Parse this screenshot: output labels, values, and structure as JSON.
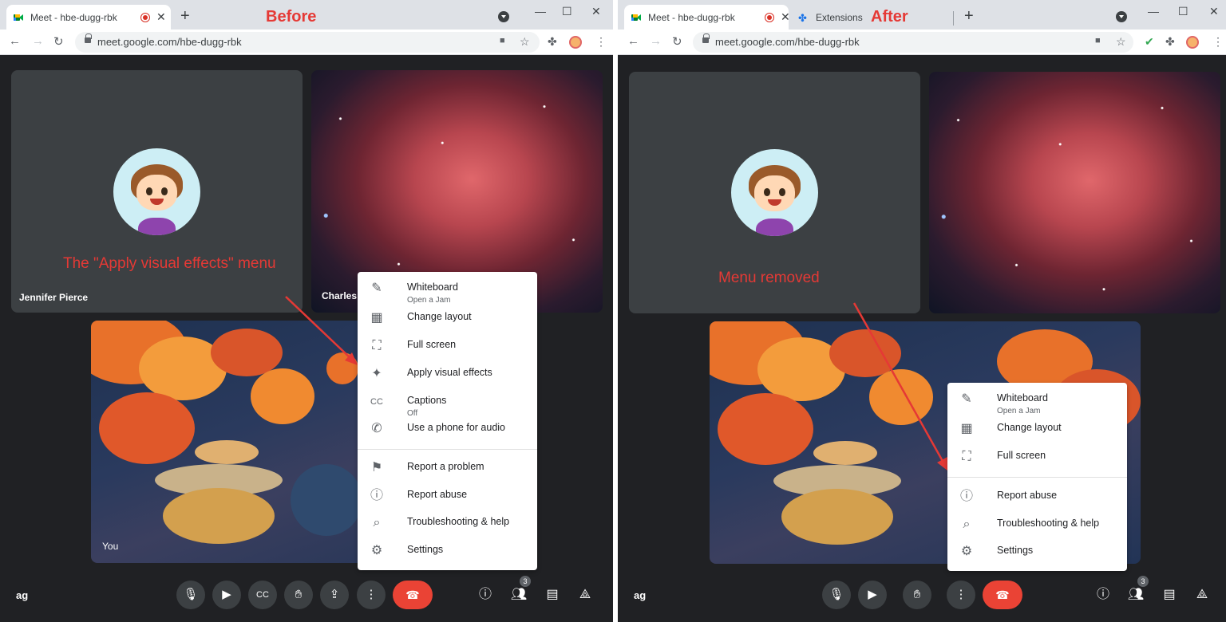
{
  "before": {
    "tabs": [
      {
        "title": "Meet - hbe-dugg-rbk"
      }
    ],
    "label": "Before",
    "url": "meet.google.com/hbe-dugg-rbk",
    "annotation": "The \"Apply visual effects\" menu",
    "participants": [
      {
        "name": "Jennifer Pierce"
      },
      {
        "name": "Charles"
      },
      {
        "name": "You"
      }
    ],
    "menu": [
      {
        "label": "Whiteboard",
        "sub": "Open a Jam",
        "icon": "pencil-icon"
      },
      {
        "label": "Change layout",
        "icon": "layout-icon"
      },
      {
        "label": "Full screen",
        "icon": "fullscreen-icon"
      },
      {
        "label": "Apply visual effects",
        "icon": "sparkle-icon"
      },
      {
        "label": "Captions",
        "sub": "Off",
        "icon": "captions-icon"
      },
      {
        "label": "Use a phone for audio",
        "icon": "phone-icon"
      },
      {
        "label": "Report a problem",
        "icon": "feedback-icon"
      },
      {
        "label": "Report abuse",
        "icon": "alert-icon"
      },
      {
        "label": "Troubleshooting & help",
        "icon": "troubleshoot-icon"
      },
      {
        "label": "Settings",
        "icon": "gear-icon"
      }
    ],
    "meeting_code": "ag",
    "people_count": "3"
  },
  "after": {
    "tabs": [
      {
        "title": "Meet - hbe-dugg-rbk"
      },
      {
        "title": "Extensions"
      }
    ],
    "label": "After",
    "url": "meet.google.com/hbe-dugg-rbk",
    "annotation": "Menu removed",
    "menu": [
      {
        "label": "Whiteboard",
        "sub": "Open a Jam",
        "icon": "pencil-icon"
      },
      {
        "label": "Change layout",
        "icon": "layout-icon"
      },
      {
        "label": "Full screen",
        "icon": "fullscreen-icon"
      },
      {
        "label": "Report abuse",
        "icon": "alert-icon"
      },
      {
        "label": "Troubleshooting & help",
        "icon": "troubleshoot-icon"
      },
      {
        "label": "Settings",
        "icon": "gear-icon"
      }
    ],
    "meeting_code": "ag",
    "people_count": "3"
  },
  "colors": {
    "annotation": "#e53935",
    "meet_bg": "#202124",
    "tile": "#3c4043",
    "end_call": "#ea4335"
  }
}
